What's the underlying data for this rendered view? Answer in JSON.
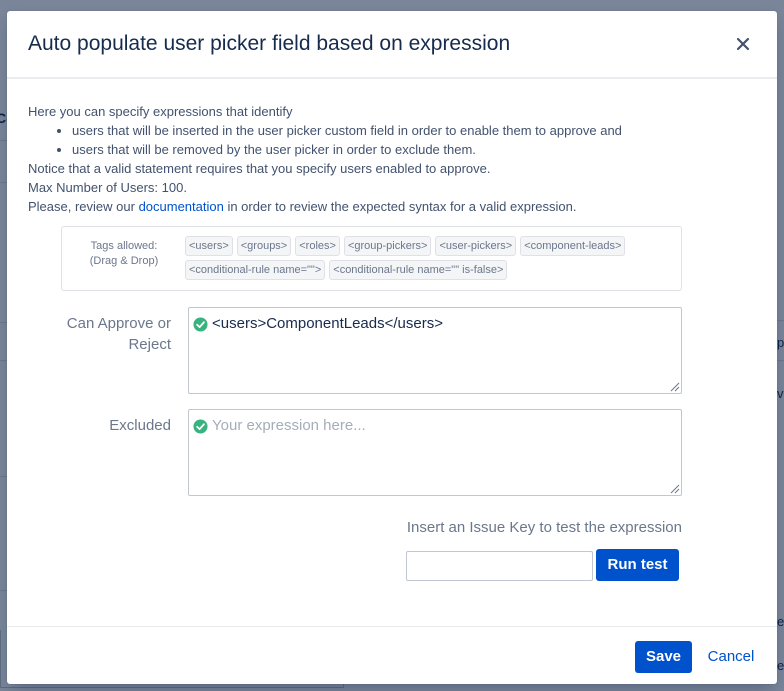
{
  "background": {
    "fragments": [
      "Co",
      "p",
      "ve",
      "ed",
      "ed"
    ]
  },
  "dialog": {
    "title": "Auto populate user picker field based on expression",
    "close_label": "×"
  },
  "intro": {
    "line1": "Here you can specify expressions that identify",
    "bullets": [
      "users that will be inserted in the user picker custom field in order to enable them to approve and",
      "users that will be removed by the user picker in order to exclude them."
    ],
    "line2": "Notice that a valid statement requires that you specify users enabled to approve.",
    "line3": "Max Number of Users: 100.",
    "line4_prefix": "Please, review our ",
    "line4_link": "documentation",
    "line4_suffix": " in order to review the expected syntax for a valid expression."
  },
  "tags": {
    "label_line1": "Tags allowed:",
    "label_line2": "(Drag & Drop)",
    "items": [
      "<users>",
      "<groups>",
      "<roles>",
      "<group-pickers>",
      "<user-pickers>",
      "<component-leads>",
      "<conditional-rule name=\"\">",
      "<conditional-rule name=\"\" is-false>"
    ]
  },
  "fields": {
    "approve": {
      "label_line1": "Can Approve or",
      "label_line2": "Reject",
      "value": "<users>ComponentLeads</users>"
    },
    "excluded": {
      "label": "Excluded",
      "placeholder": "Your expression here..."
    }
  },
  "test": {
    "label": "Insert an Issue Key to test the expression",
    "input_value": "",
    "run_label": "Run test"
  },
  "footer": {
    "save_label": "Save",
    "cancel_label": "Cancel"
  },
  "colors": {
    "primary": "#0052cc",
    "valid_check": "#36b37e"
  }
}
